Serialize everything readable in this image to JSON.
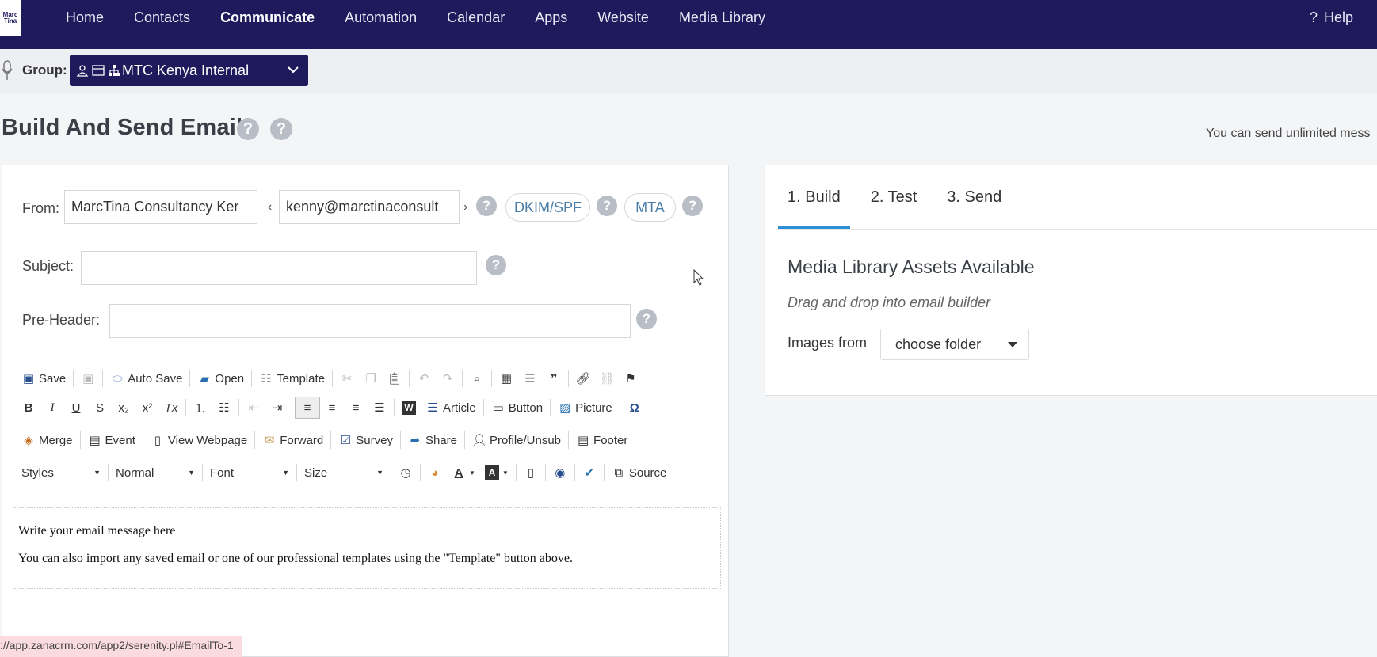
{
  "topnav": {
    "logo_text": "Marc Tina",
    "items": [
      "Home",
      "Contacts",
      "Communicate",
      "Automation",
      "Calendar",
      "Apps",
      "Website",
      "Media Library"
    ],
    "active": "Communicate",
    "help_label": "Help",
    "bg_color": "#1f1a5c"
  },
  "groupbar": {
    "label": "Group:",
    "selected": "MTC Kenya Internal"
  },
  "page": {
    "title": "Build And Send Email",
    "unlimited_text": "You can send unlimited mess"
  },
  "form": {
    "from_label": "From:",
    "from_name": "MarcTina Consultancy Ker",
    "from_email": "kenny@marctinaconsult",
    "dkim_label": "DKIM/SPF",
    "mta_label": "MTA",
    "subject_label": "Subject:",
    "subject_value": "",
    "preheader_label": "Pre-Header:",
    "preheader_value": ""
  },
  "toolbar": {
    "row1": {
      "save": "Save",
      "autosave": "Auto Save",
      "open": "Open",
      "template": "Template"
    },
    "row2": {
      "article": "Article",
      "button": "Button",
      "picture": "Picture"
    },
    "row3": {
      "merge": "Merge",
      "event": "Event",
      "view_webpage": "View Webpage",
      "forward": "Forward",
      "survey": "Survey",
      "share": "Share",
      "profile": "Profile/Unsub",
      "footer": "Footer"
    },
    "row4": {
      "styles": "Styles",
      "format": "Normal",
      "font": "Font",
      "size": "Size",
      "source": "Source"
    }
  },
  "editor": {
    "line1": "Write your email message here",
    "line2": "You can also import any saved email or one of our professional templates using the \"Template\" button above."
  },
  "status_url": "://app.zanacrm.com/app2/serenity.pl#EmailTo-1",
  "right": {
    "tabs": [
      "1. Build",
      "2. Test",
      "3. Send"
    ],
    "active_tab": "1. Build",
    "media_title": "Media Library Assets Available",
    "media_sub": "Drag and drop into email builder",
    "images_from_label": "Images from",
    "folder_value": "choose folder"
  }
}
